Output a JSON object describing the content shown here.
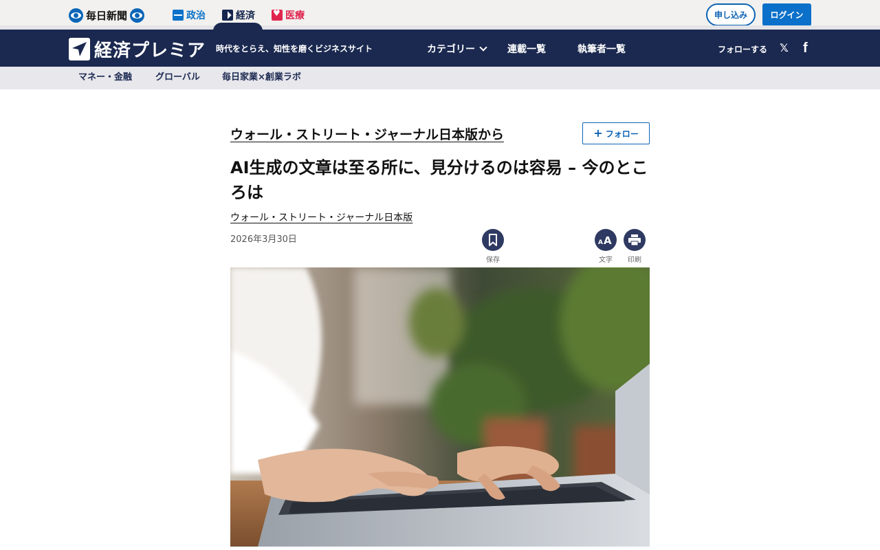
{
  "topbar": {
    "newspaper_name": "毎日新聞",
    "sites": [
      {
        "label": "政治"
      },
      {
        "label": "経済"
      },
      {
        "label": "医療"
      }
    ],
    "apply_label": "申し込み",
    "login_label": "ログイン"
  },
  "header": {
    "brand_name": "経済プレミア",
    "tagline": "時代をとらえ、知性を磨くビジネスサイト",
    "nav": {
      "category": "カテゴリー",
      "series": "連載一覧",
      "writers": "執筆者一覧"
    },
    "follow_label": "フォローする",
    "social_icons": [
      "x-icon",
      "facebook-icon"
    ]
  },
  "subnav": {
    "items": [
      {
        "label": "マネー・金融"
      },
      {
        "label": "グローバル"
      },
      {
        "label": "毎日家業×創業ラボ"
      }
    ]
  },
  "article": {
    "source_title": "ウォール・ストリート・ジャーナル日本版から",
    "follow_button": "フォロー",
    "headline": "AI生成の文章は至る所に、見分けるのは容易 – 今のところは",
    "byline": "ウォール・ストリート・ジャーナル日本版",
    "date": "2026年3月30日",
    "tools": {
      "save": "保存",
      "text_size": "文字",
      "print": "印刷"
    }
  },
  "colors": {
    "navy": "#1b2950",
    "accent_blue": "#0b70c9",
    "medical_red": "#e0264f"
  }
}
